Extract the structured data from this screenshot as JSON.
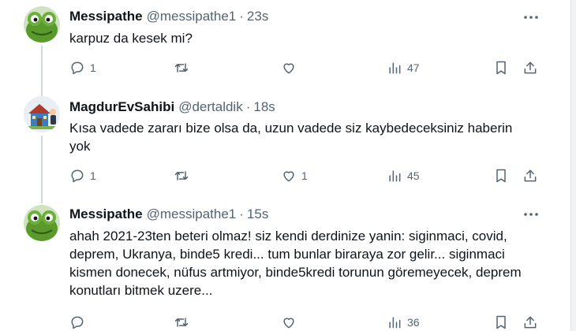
{
  "tweets": [
    {
      "avatar": "kermit-frog",
      "name": "Messipathe",
      "handle": "@messipathe1",
      "separator": "·",
      "time": "23s",
      "text": "karpuz da kesek mi?",
      "replies": "1",
      "retweets": "",
      "likes": "",
      "views": "47"
    },
    {
      "avatar": "house-cartoon",
      "name": "MagdurEvSahibi",
      "handle": "@dertaldik",
      "separator": "·",
      "time": "18s",
      "text": "Kısa vadede zararı bize olsa da, uzun vadede siz kaybedeceksiniz haberin yok",
      "replies": "1",
      "retweets": "",
      "likes": "1",
      "views": "45"
    },
    {
      "avatar": "kermit-frog",
      "name": "Messipathe",
      "handle": "@messipathe1",
      "separator": "·",
      "time": "15s",
      "text": "ahah 2021-23ten beteri olmaz! siz kendi derdinize yanin:  siginmaci, covid, deprem, Ukranya, binde5 kredi... tum bunlar biraraya zor gelir... siginmaci kismen donecek, nüfus artmiyor, binde5kredi torunun göremeyecek, deprem konutları bitmek uzere...",
      "replies": "",
      "retweets": "",
      "likes": "",
      "views": "36"
    }
  ],
  "icons": {
    "reply": "reply-icon",
    "retweet": "retweet-icon",
    "like": "heart-icon",
    "views": "views-chart-icon",
    "bookmark": "bookmark-icon",
    "share": "share-icon",
    "more": "more-dots-icon"
  },
  "colors": {
    "text": "#0f1419",
    "muted": "#536471",
    "thread_line": "#cfd9de",
    "divider": "#eff3f4",
    "kermit_green": "#5a9a2c"
  }
}
